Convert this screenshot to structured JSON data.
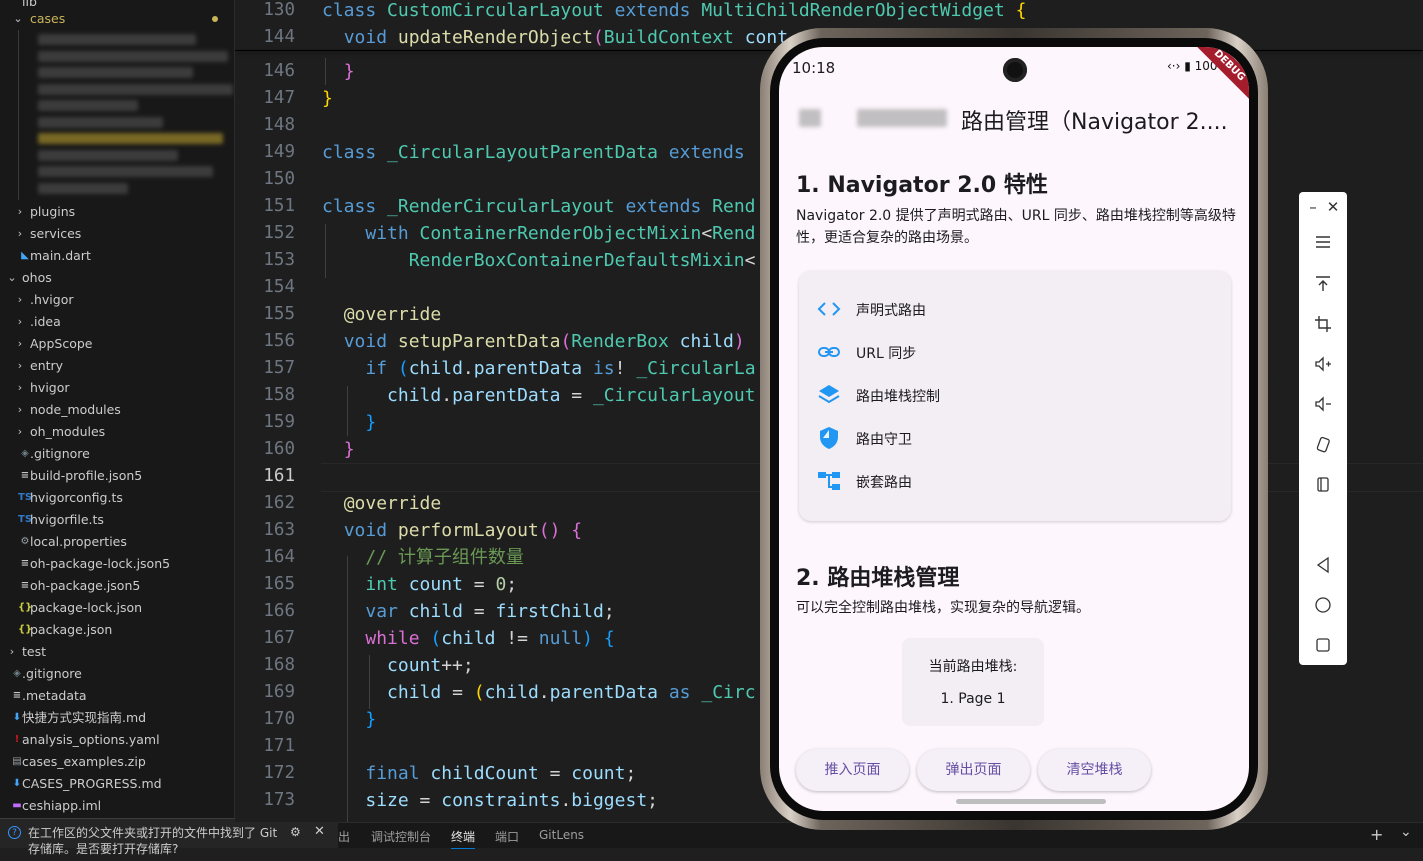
{
  "explorer": {
    "top_items": [
      {
        "label": "lib",
        "chevron": "",
        "icon": ""
      },
      {
        "label": "cases",
        "chevron": "⌄",
        "icon": ""
      }
    ],
    "items": [
      {
        "label": "plugins",
        "chevron": "›",
        "icon": ""
      },
      {
        "label": "services",
        "chevron": "›",
        "icon": ""
      },
      {
        "label": "main.dart",
        "chevron": "",
        "icon": "◣"
      },
      {
        "label": "ohos",
        "chevron": "⌄",
        "icon": ""
      },
      {
        "label": ".hvigor",
        "chevron": "›",
        "icon": ""
      },
      {
        "label": ".idea",
        "chevron": "›",
        "icon": ""
      },
      {
        "label": "AppScope",
        "chevron": "›",
        "icon": ""
      },
      {
        "label": "entry",
        "chevron": "›",
        "icon": ""
      },
      {
        "label": "hvigor",
        "chevron": "›",
        "icon": ""
      },
      {
        "label": "node_modules",
        "chevron": "›",
        "icon": ""
      },
      {
        "label": "oh_modules",
        "chevron": "›",
        "icon": ""
      },
      {
        "label": ".gitignore",
        "chevron": "",
        "icon": "◈"
      },
      {
        "label": "build-profile.json5",
        "chevron": "",
        "icon": "≡"
      },
      {
        "label": "hvigorconfig.ts",
        "chevron": "",
        "icon": "TS"
      },
      {
        "label": "hvigorfile.ts",
        "chevron": "",
        "icon": "TS"
      },
      {
        "label": "local.properties",
        "chevron": "",
        "icon": "⚙"
      },
      {
        "label": "oh-package-lock.json5",
        "chevron": "",
        "icon": "≡"
      },
      {
        "label": "oh-package.json5",
        "chevron": "",
        "icon": "≡"
      },
      {
        "label": "package-lock.json",
        "chevron": "",
        "icon": "{}"
      },
      {
        "label": "package.json",
        "chevron": "",
        "icon": "{}"
      },
      {
        "label": "test",
        "chevron": "›",
        "icon": ""
      },
      {
        "label": ".gitignore",
        "chevron": "",
        "icon": "◈"
      },
      {
        "label": ".metadata",
        "chevron": "",
        "icon": "≡"
      },
      {
        "label": "快捷方式实现指南.md",
        "chevron": "",
        "icon": "⬇"
      },
      {
        "label": "analysis_options.yaml",
        "chevron": "",
        "icon": "!"
      },
      {
        "label": "cases_examples.zip",
        "chevron": "",
        "icon": "▤"
      },
      {
        "label": "CASES_PROGRESS.md",
        "chevron": "",
        "icon": "⬇"
      },
      {
        "label": "ceshiapp.iml",
        "chevron": "",
        "icon": "▬"
      }
    ]
  },
  "notification": {
    "text": "在工作区的父文件夹或打开的文件中找到了 Git 存储库。是否要打开存储库?",
    "gear_icon": "gear-icon",
    "close_icon": "close-icon"
  },
  "editor": {
    "current_line": "161",
    "lines": [
      {
        "no": "130",
        "tokens": [
          [
            "k",
            "class "
          ],
          [
            "c",
            "CustomCircularLayout "
          ],
          [
            "k",
            "extends "
          ],
          [
            "c",
            "MultiChildRenderObjectWidget "
          ],
          [
            "b",
            "{"
          ]
        ]
      },
      {
        "no": "144",
        "tokens": [
          [
            "",
            "  "
          ],
          [
            "k",
            "void "
          ],
          [
            "f",
            "updateRenderObject"
          ],
          [
            "p",
            "("
          ],
          [
            "c",
            "BuildContext "
          ],
          [
            "v",
            "cont"
          ]
        ]
      },
      {
        "no": "146",
        "tokens": [
          [
            "",
            "  "
          ],
          [
            "p",
            "}"
          ]
        ]
      },
      {
        "no": "147",
        "tokens": [
          [
            "b",
            "}"
          ]
        ]
      },
      {
        "no": "148",
        "tokens": []
      },
      {
        "no": "149",
        "tokens": [
          [
            "k",
            "class "
          ],
          [
            "c",
            "_CircularLayoutParentData "
          ],
          [
            "k",
            "extends"
          ]
        ]
      },
      {
        "no": "150",
        "tokens": []
      },
      {
        "no": "151",
        "tokens": [
          [
            "k",
            "class "
          ],
          [
            "c",
            "_RenderCircularLayout "
          ],
          [
            "k",
            "extends "
          ],
          [
            "c",
            "Rend"
          ]
        ]
      },
      {
        "no": "152",
        "tokens": [
          [
            "",
            "    "
          ],
          [
            "k",
            "with "
          ],
          [
            "c",
            "ContainerRenderObjectMixin"
          ],
          [
            "",
            "<"
          ],
          [
            "c",
            "Rend"
          ]
        ]
      },
      {
        "no": "153",
        "tokens": [
          [
            "",
            "        "
          ],
          [
            "c",
            "RenderBoxContainerDefaultsMixin"
          ],
          [
            "",
            "<"
          ]
        ]
      },
      {
        "no": "154",
        "tokens": []
      },
      {
        "no": "155",
        "tokens": [
          [
            "",
            "  "
          ],
          [
            "f",
            "@override"
          ]
        ]
      },
      {
        "no": "156",
        "tokens": [
          [
            "",
            "  "
          ],
          [
            "k",
            "void "
          ],
          [
            "f",
            "setupParentData"
          ],
          [
            "p",
            "("
          ],
          [
            "c",
            "RenderBox "
          ],
          [
            "v",
            "child"
          ],
          [
            "p",
            ")"
          ]
        ]
      },
      {
        "no": "157",
        "tokens": [
          [
            "",
            "    "
          ],
          [
            "k",
            "if "
          ],
          [
            "bl",
            "("
          ],
          [
            "v",
            "child"
          ],
          [
            "",
            "."
          ],
          [
            "v",
            "parentData "
          ],
          [
            "k",
            "is"
          ],
          [
            "",
            "! "
          ],
          [
            "c",
            "_CircularLa"
          ]
        ]
      },
      {
        "no": "158",
        "tokens": [
          [
            "",
            "      "
          ],
          [
            "v",
            "child"
          ],
          [
            "",
            "."
          ],
          [
            "v",
            "parentData "
          ],
          [
            "",
            "= "
          ],
          [
            "c",
            "_CircularLayout"
          ]
        ]
      },
      {
        "no": "159",
        "tokens": [
          [
            "",
            "    "
          ],
          [
            "bl",
            "}"
          ]
        ]
      },
      {
        "no": "160",
        "tokens": [
          [
            "",
            "  "
          ],
          [
            "p",
            "}"
          ]
        ]
      },
      {
        "no": "161",
        "tokens": []
      },
      {
        "no": "162",
        "tokens": [
          [
            "",
            "  "
          ],
          [
            "f",
            "@override"
          ]
        ]
      },
      {
        "no": "163",
        "tokens": [
          [
            "",
            "  "
          ],
          [
            "k",
            "void "
          ],
          [
            "f",
            "performLayout"
          ],
          [
            "p",
            "() {"
          ]
        ]
      },
      {
        "no": "164",
        "tokens": [
          [
            "",
            "    "
          ],
          [
            "cm",
            "// 计算子组件数量"
          ]
        ]
      },
      {
        "no": "165",
        "tokens": [
          [
            "",
            "    "
          ],
          [
            "c",
            "int "
          ],
          [
            "v",
            "count "
          ],
          [
            "",
            "= "
          ],
          [
            "n",
            "0"
          ],
          [
            "",
            ";"
          ]
        ]
      },
      {
        "no": "166",
        "tokens": [
          [
            "",
            "    "
          ],
          [
            "k",
            "var "
          ],
          [
            "v",
            "child "
          ],
          [
            "",
            "= "
          ],
          [
            "v",
            "firstChild"
          ],
          [
            "",
            ";"
          ]
        ]
      },
      {
        "no": "167",
        "tokens": [
          [
            "",
            "    "
          ],
          [
            "p",
            "while "
          ],
          [
            "bl",
            "("
          ],
          [
            "v",
            "child "
          ],
          [
            "",
            "!= "
          ],
          [
            "k",
            "null"
          ],
          [
            "bl",
            ") {"
          ]
        ]
      },
      {
        "no": "168",
        "tokens": [
          [
            "",
            "      "
          ],
          [
            "v",
            "count"
          ],
          [
            "",
            "++;"
          ]
        ]
      },
      {
        "no": "169",
        "tokens": [
          [
            "",
            "      "
          ],
          [
            "v",
            "child "
          ],
          [
            "",
            "= "
          ],
          [
            "b",
            "("
          ],
          [
            "v",
            "child"
          ],
          [
            "",
            "."
          ],
          [
            "v",
            "parentData "
          ],
          [
            "k",
            "as "
          ],
          [
            "c",
            "_Circ"
          ]
        ]
      },
      {
        "no": "170",
        "tokens": [
          [
            "",
            "    "
          ],
          [
            "bl",
            "}"
          ]
        ]
      },
      {
        "no": "171",
        "tokens": []
      },
      {
        "no": "172",
        "tokens": [
          [
            "",
            "    "
          ],
          [
            "k",
            "final "
          ],
          [
            "v",
            "childCount "
          ],
          [
            "",
            "= "
          ],
          [
            "v",
            "count"
          ],
          [
            "",
            ";"
          ]
        ]
      },
      {
        "no": "173",
        "tokens": [
          [
            "",
            "    "
          ],
          [
            "v",
            "size "
          ],
          [
            "",
            "= "
          ],
          [
            "v",
            "constraints"
          ],
          [
            "",
            "."
          ],
          [
            "v",
            "biggest"
          ],
          [
            "",
            ";"
          ]
        ]
      }
    ]
  },
  "panel_tabs": [
    {
      "label": "出",
      "active": false
    },
    {
      "label": "调试控制台",
      "active": false
    },
    {
      "label": "终端",
      "active": true
    },
    {
      "label": "端口",
      "active": false
    },
    {
      "label": "GitLens",
      "active": false
    }
  ],
  "panel_actions": {
    "add": "+",
    "more": "⌄"
  },
  "emulator_toolbar": {
    "icons": [
      "minimize-icon",
      "close-icon",
      "menu-icon",
      "pin-top-icon",
      "crop-icon",
      "volume-up-icon",
      "volume-down-icon",
      "rotate-icon",
      "fold-icon",
      "back-icon",
      "home-icon",
      "recents-icon"
    ]
  },
  "phone": {
    "status": {
      "time": "10:18",
      "icons": "‹·› ▮ 100"
    },
    "debug_banner": "DEBUG",
    "appbar": {
      "title": "路由管理（Navigator 2...."
    },
    "section1": {
      "heading": "1. Navigator 2.0 特性",
      "desc": "Navigator 2.0 提供了声明式路由、URL 同步、路由堆栈控制等高级特性，更适合复杂的路由场景。",
      "features": [
        {
          "icon": "code-icon",
          "label": "声明式路由"
        },
        {
          "icon": "link-icon",
          "label": "URL 同步"
        },
        {
          "icon": "layers-icon",
          "label": "路由堆栈控制"
        },
        {
          "icon": "shield-icon",
          "label": "路由守卫"
        },
        {
          "icon": "account-tree-icon",
          "label": "嵌套路由"
        }
      ]
    },
    "section2": {
      "heading": "2. 路由堆栈管理",
      "desc": "可以完全控制路由堆栈，实现复杂的导航逻辑。",
      "stack_label": "当前路由堆栈:",
      "stack_items": [
        "1. Page 1"
      ]
    },
    "buttons": {
      "push": "推入页面",
      "pop": "弹出页面",
      "clear": "清空堆栈"
    },
    "accent_color": "#6750a4",
    "icon_color": "#2196f3"
  },
  "colors": {
    "editor_bg": "#1e1e1e",
    "explorer_bg": "#181818",
    "phone_bg": "#fdf7fd"
  }
}
